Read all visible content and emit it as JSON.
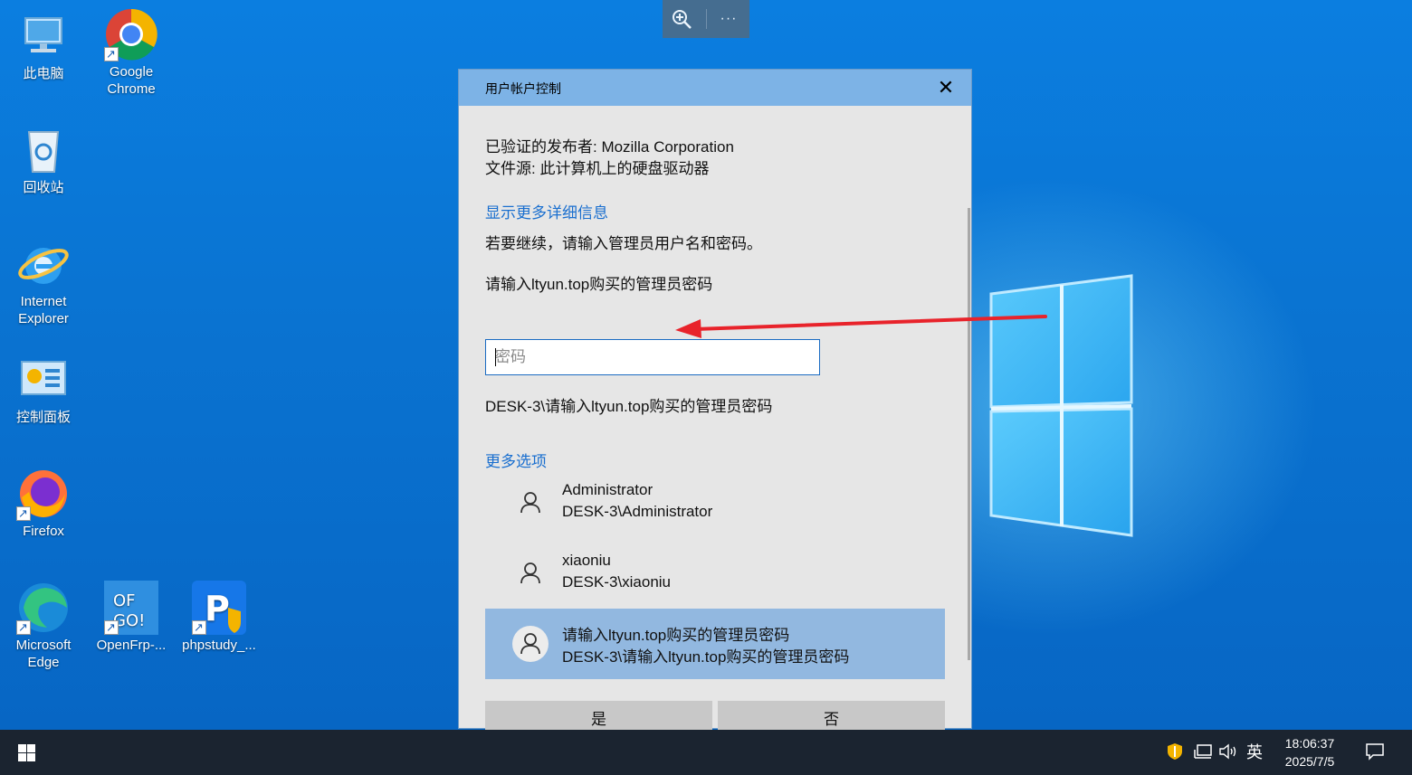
{
  "desktop": {
    "icons": [
      {
        "label": "此电脑"
      },
      {
        "label": "Google Chrome"
      },
      {
        "label": "回收站"
      },
      {
        "label": "Internet Explorer"
      },
      {
        "label": "控制面板"
      },
      {
        "label": "Firefox"
      },
      {
        "label": "Microsoft Edge"
      },
      {
        "label": "OpenFrp-..."
      },
      {
        "label": "phpstudy_..."
      }
    ]
  },
  "floating_toolbar": {
    "zoom_icon": "zoom-in-icon",
    "more_icon": "more-icon",
    "more_label": "···"
  },
  "uac": {
    "title": "用户帐户控制",
    "close_label": "✕",
    "publisher": "已验证的发布者: Mozilla Corporation",
    "file_origin": "文件源: 此计算机上的硬盘驱动器",
    "show_details_link": "显示更多详细信息",
    "instruction": "若要继续，请输入管理员用户名和密码。",
    "selected_account_title": "请输入ltyun.top购买的管理员密码",
    "password_placeholder": "密码",
    "domain_user": "DESK-3\\请输入ltyun.top购买的管理员密码",
    "more_options_link": "更多选项",
    "accounts": [
      {
        "name": "Administrator",
        "domain": "DESK-3\\Administrator",
        "selected": false
      },
      {
        "name": "xiaoniu",
        "domain": "DESK-3\\xiaoniu",
        "selected": false
      },
      {
        "name": "请输入ltyun.top购买的管理员密码",
        "domain": "DESK-3\\请输入ltyun.top购买的管理员密码",
        "selected": true
      }
    ],
    "yes_button": "是",
    "no_button": "否"
  },
  "annotation": {
    "color": "#e8232b"
  },
  "taskbar": {
    "ime_label": "英",
    "time": "18:06:37",
    "date": "2025/7/5"
  },
  "colors": {
    "accent": "#1a6fcf",
    "title_bar": "#7db3e6",
    "selected_row": "#92b8e0"
  }
}
